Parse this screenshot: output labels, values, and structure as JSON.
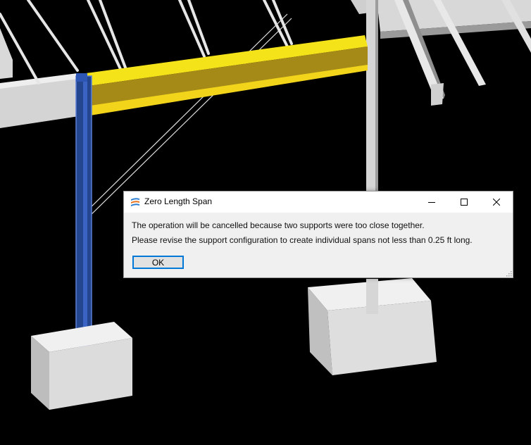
{
  "dialog": {
    "title": "Zero Length Span",
    "message_line1": "The operation will be cancelled because two supports were too close together.",
    "message_line2": "Please revise the support configuration to create individual spans not less than 0.25 ft long.",
    "ok_label": "OK",
    "icons": {
      "app": "app-logo-icon",
      "minimize": "minimize-icon",
      "maximize": "maximize-icon",
      "close": "close-icon",
      "resize": "resize-grip-icon"
    }
  },
  "colors": {
    "background": "#000000",
    "selected_column": "#2b4f9e",
    "highlighted_beam": "#f5e31a",
    "concrete": "#e4e4e4",
    "focus_border": "#0078d7"
  }
}
